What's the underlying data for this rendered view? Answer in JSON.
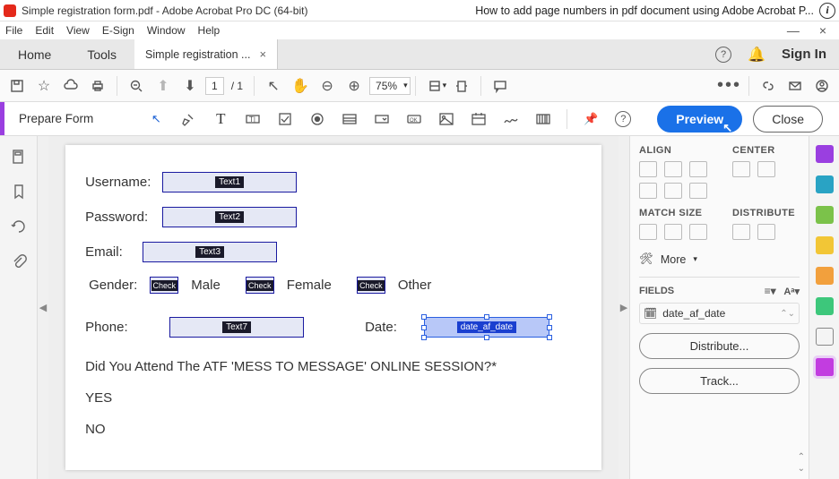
{
  "titlebar": {
    "title": "Simple registration form.pdf - Adobe Acrobat Pro DC (64-bit)",
    "tip": "How to add page numbers in pdf document using Adobe Acrobat P..."
  },
  "menu": [
    "File",
    "Edit",
    "View",
    "E-Sign",
    "Window",
    "Help"
  ],
  "tabs": {
    "home": "Home",
    "tools": "Tools",
    "doc": "Simple registration ...",
    "signin": "Sign In"
  },
  "maintb": {
    "page_cur": "1",
    "page_total": "/  1",
    "zoom": "75%"
  },
  "prep": {
    "label": "Prepare Form",
    "preview": "Preview",
    "close": "Close"
  },
  "form": {
    "username_lbl": "Username:",
    "username_tag": "Text1",
    "password_lbl": "Password:",
    "password_tag": "Text2",
    "email_lbl": "Email:",
    "email_tag": "Text3",
    "gender_lbl": "Gender:",
    "male": "Male",
    "female": "Female",
    "other": "Other",
    "chk": "Check",
    "phone_lbl": "Phone:",
    "phone_tag": "Text7",
    "date_lbl": "Date:",
    "date_tag": "date_af_date",
    "question": "Did You Attend The ATF 'MESS TO MESSAGE' ONLINE SESSION?*",
    "yes": "YES",
    "no": "NO"
  },
  "panel": {
    "align": "ALIGN",
    "center": "CENTER",
    "match": "MATCH SIZE",
    "distribute": "DISTRIBUTE",
    "more": "More",
    "fields": "FIELDS",
    "field1": "date_af_date",
    "dist_btn": "Distribute...",
    "track_btn": "Track..."
  }
}
